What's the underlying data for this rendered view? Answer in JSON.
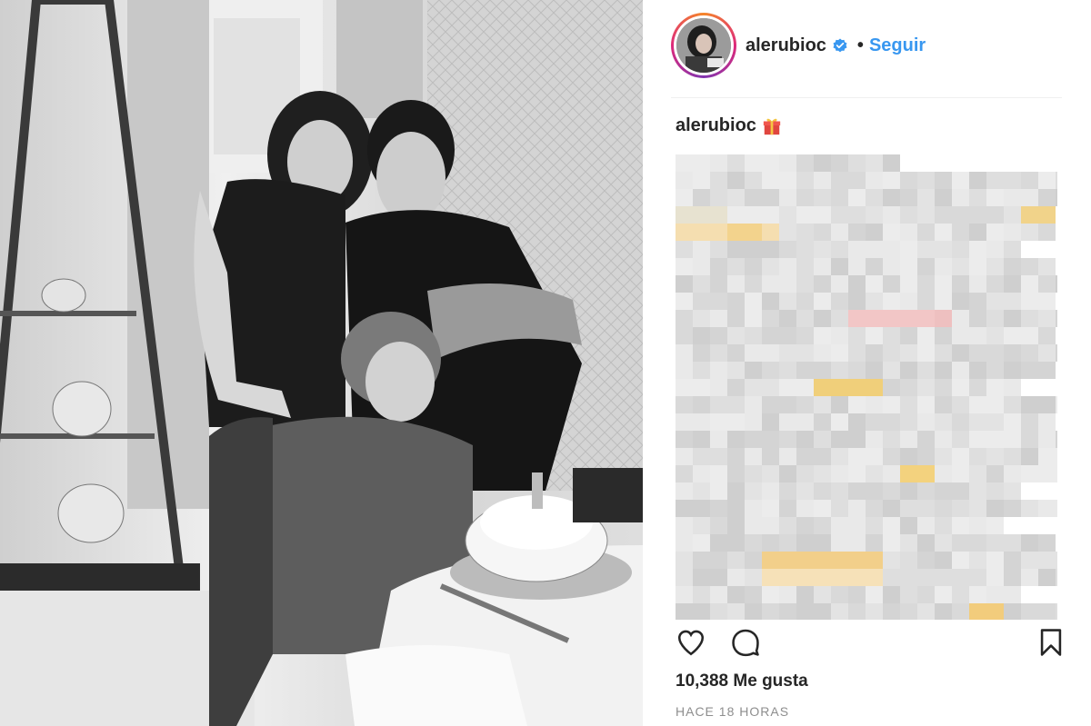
{
  "post": {
    "username": "alerubioc",
    "verified_icon": "verified-badge-icon",
    "separator": "•",
    "follow_label": "Seguir",
    "accent_color": "#3897f0",
    "photo_alt": "black-and-white family birthday photo"
  },
  "caption": {
    "username": "alerubioc",
    "emoji_icon": "gift-icon"
  },
  "actions": {
    "like_icon": "heart-icon",
    "comment_icon": "comment-icon",
    "save_icon": "bookmark-icon"
  },
  "stats": {
    "likes": "10,388 Me gusta",
    "time": "HACE 18 HORAS"
  }
}
